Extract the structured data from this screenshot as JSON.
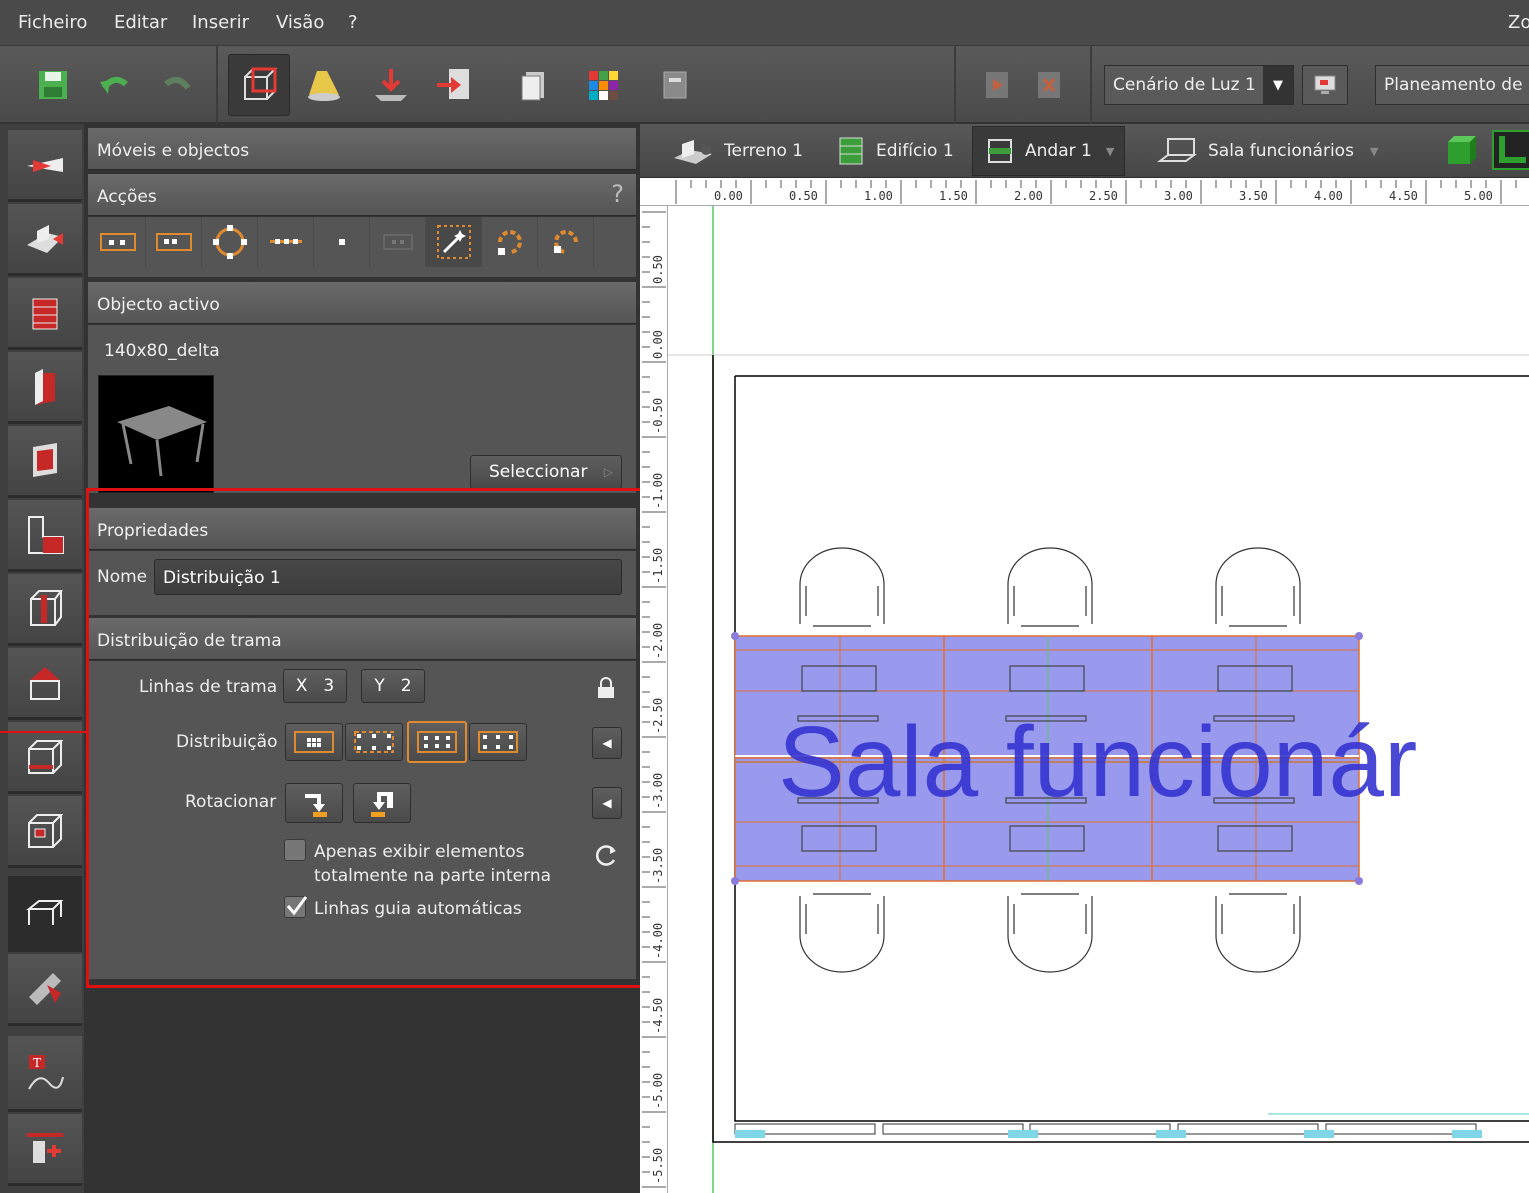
{
  "menu": [
    "Ficheiro",
    "Editar",
    "Inserir",
    "Visão",
    "?"
  ],
  "menu_right_partial": "Zo",
  "toolbar": {
    "light_scene": "Cenário de Luz 1",
    "planning_partial": "Planeamento de e"
  },
  "tabs": {
    "terrain": "Terreno 1",
    "building": "Edifício 1",
    "floor": "Andar 1",
    "room": "Sala funcionários"
  },
  "panel": {
    "title": "Móveis e objectos",
    "actions_header": "Acções",
    "help": "?",
    "active_object_header": "Objecto activo",
    "object_name": "140x80_delta",
    "select_button": "Seleccionar",
    "properties_header": "Propriedades",
    "name_label": "Nome",
    "name_value": "Distribuição 1",
    "grid_header": "Distribuição de trama",
    "grid_lines_label": "Linhas de trama",
    "x_label": "X",
    "x_value": "3",
    "y_label": "Y",
    "y_value": "2",
    "distribution_label": "Distribuição",
    "rotate_label": "Rotacionar",
    "only_inside_label_1": "Apenas exibir elementos",
    "only_inside_label_2": "totalmente na parte interna",
    "auto_guides_label": "Linhas guia automáticas",
    "auto_guides_checked": true,
    "only_inside_checked": false
  },
  "ruler": {
    "top": [
      "0.00",
      "0.50",
      "1.00",
      "1.50",
      "2.00",
      "2.50",
      "3.00",
      "3.50",
      "4.00",
      "4.50",
      "5.00"
    ],
    "left": [
      "0.50",
      "0.00",
      "-0.50",
      "-1.00",
      "-1.50",
      "-2.00",
      "-2.50",
      "-3.00",
      "-3.50",
      "-4.00",
      "-4.50",
      "-5.00",
      "-5.50"
    ]
  },
  "plan": {
    "room_label": "Sala funcionár"
  },
  "colors": {
    "selection_fill": "#9999ee",
    "selection_stroke": "#e07030",
    "room_text": "#3434d0",
    "highlight_frame": "#e01010"
  }
}
